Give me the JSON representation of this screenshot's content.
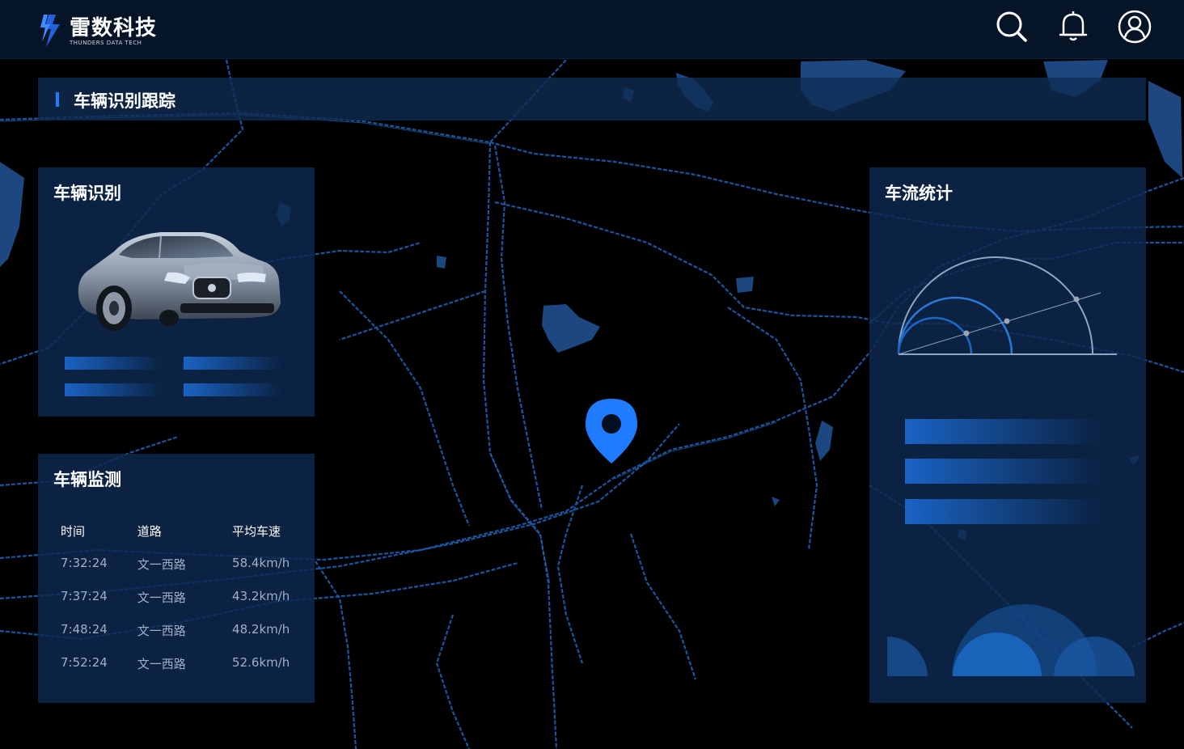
{
  "app": {
    "brand_name": "雷数科技",
    "brand_subtitle": "THUNDERS DATA TECH"
  },
  "header": {
    "icons": [
      "search-icon",
      "bell-icon",
      "user-icon"
    ]
  },
  "page": {
    "title": "车辆识别跟踪"
  },
  "vehicle_recognition": {
    "title": "车辆识别"
  },
  "vehicle_monitoring": {
    "title": "车辆监测",
    "columns": [
      "时间",
      "道路",
      "平均车速"
    ],
    "rows": [
      [
        "7:32:24",
        "文一西路",
        "58.4km/h"
      ],
      [
        "7:37:24",
        "文一西路",
        "43.2km/h"
      ],
      [
        "7:48:24",
        "文一西路",
        "48.2km/h"
      ],
      [
        "7:52:24",
        "文一西路",
        "52.6km/h"
      ]
    ]
  },
  "traffic_stats": {
    "title": "车流统计"
  },
  "colors": {
    "accent": "#1f7bff",
    "panel": "#0d2a50",
    "background": "#000000",
    "topbar": "#061427"
  }
}
